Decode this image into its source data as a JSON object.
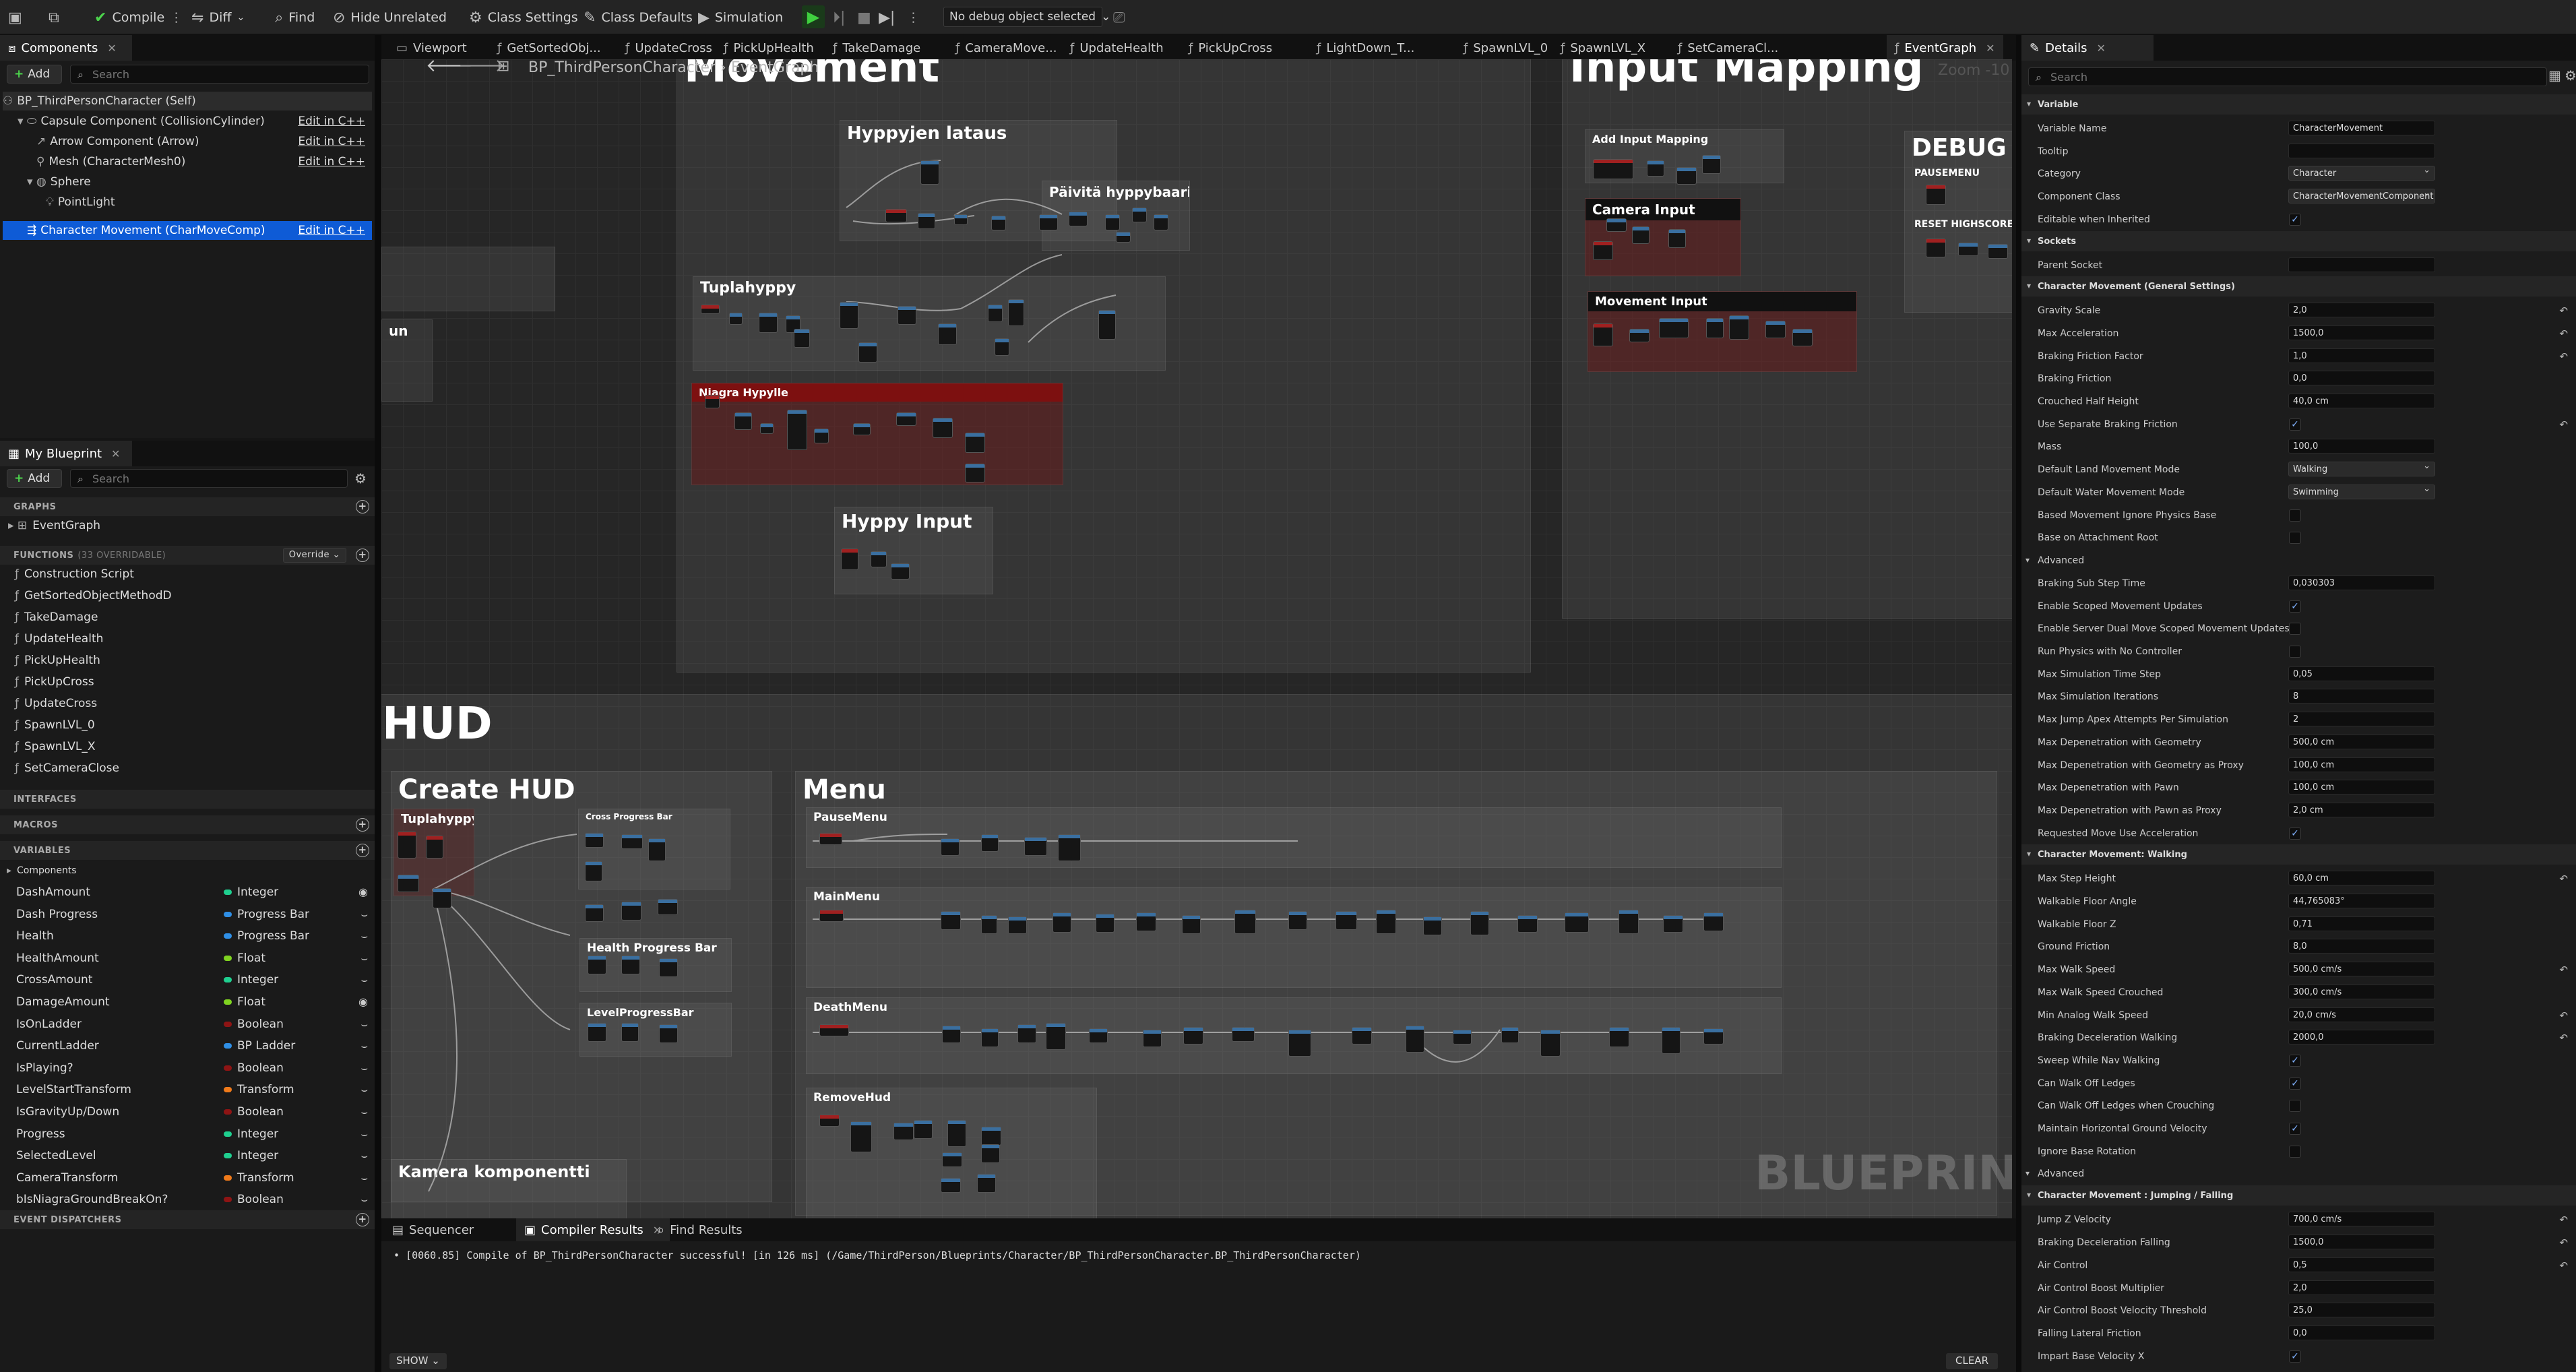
{
  "toolbar": {
    "compile": "Compile",
    "diff": "Diff",
    "find": "Find",
    "hide_unrelated": "Hide Unrelated",
    "class_settings": "Class Settings",
    "class_defaults": "Class Defaults",
    "simulation": "Simulation",
    "debug_object": "No debug object selected"
  },
  "components_panel": {
    "tab": "Components",
    "add": "Add",
    "search_placeholder": "Search",
    "items": [
      {
        "label": "BP_ThirdPersonCharacter (Self)",
        "edit": ""
      },
      {
        "label": "Capsule Component (CollisionCylinder)",
        "edit": "Edit in C++"
      },
      {
        "label": "Arrow Component (Arrow)",
        "edit": "Edit in C++"
      },
      {
        "label": "Mesh (CharacterMesh0)",
        "edit": "Edit in C++"
      },
      {
        "label": "Sphere",
        "edit": ""
      },
      {
        "label": "PointLight",
        "edit": ""
      },
      {
        "label": "Character Movement (CharMoveComp)",
        "edit": "Edit in C++"
      }
    ]
  },
  "my_blueprint": {
    "tab": "My Blueprint",
    "add": "Add",
    "search_placeholder": "Search",
    "graphs_header": "GRAPHS",
    "event_graph": "EventGraph",
    "functions_header": "FUNCTIONS",
    "functions_count": "(33 OVERRIDABLE)",
    "override": "Override",
    "functions": [
      "Construction Script",
      "GetSortedObjectMethodD",
      "TakeDamage",
      "UpdateHealth",
      "PickUpHealth",
      "PickUpCross",
      "UpdateCross",
      "SpawnLVL_0",
      "SpawnLVL_X",
      "SetCameraClose"
    ],
    "interfaces_header": "INTERFACES",
    "macros_header": "MACROS",
    "variables_header": "VARIABLES",
    "components_group": "Components",
    "variables": [
      {
        "name": "DashAmount",
        "type": "Integer",
        "color": "#1fcf8f"
      },
      {
        "name": "Dash Progress",
        "type": "Progress Bar",
        "color": "#2f8fe6"
      },
      {
        "name": "Health",
        "type": "Progress Bar",
        "color": "#2f8fe6"
      },
      {
        "name": "HealthAmount",
        "type": "Float",
        "color": "#7fd320"
      },
      {
        "name": "CrossAmount",
        "type": "Integer",
        "color": "#1fcf8f"
      },
      {
        "name": "DamageAmount",
        "type": "Float",
        "color": "#7fd320"
      },
      {
        "name": "IsOnLadder",
        "type": "Boolean",
        "color": "#8e1414"
      },
      {
        "name": "CurrentLadder",
        "type": "BP Ladder",
        "color": "#2f8fe6"
      },
      {
        "name": "IsPlaying?",
        "type": "Boolean",
        "color": "#8e1414"
      },
      {
        "name": "LevelStartTransform",
        "type": "Transform",
        "color": "#f07a1a"
      },
      {
        "name": "IsGravityUp/Down",
        "type": "Boolean",
        "color": "#8e1414"
      },
      {
        "name": "Progress",
        "type": "Integer",
        "color": "#1fcf8f"
      },
      {
        "name": "SelectedLevel",
        "type": "Integer",
        "color": "#1fcf8f"
      },
      {
        "name": "CameraTransform",
        "type": "Transform",
        "color": "#f07a1a"
      },
      {
        "name": "bIsNiagraGroundBreakOn?",
        "type": "Boolean",
        "color": "#8e1414"
      }
    ],
    "event_dispatchers_header": "EVENT DISPATCHERS"
  },
  "editor_tabs": [
    "Viewport",
    "GetSortedObj...",
    "UpdateCross",
    "PickUpHealth",
    "TakeDamage",
    "CameraMove...",
    "UpdateHealth",
    "PickUpCross",
    "LightDown_T...",
    "SpawnLVL_0",
    "SpawnLVL_X",
    "SetCameraCl...",
    "EventGraph"
  ],
  "graph": {
    "breadcrumb_bp": "BP_ThirdPersonCharacter",
    "breadcrumb_graph": "EventGraph",
    "zoom": "Zoom -10",
    "watermark": "BLUEPRINT",
    "comments": {
      "movement": "Movement",
      "hyppyjen_lataus": "Hyppyjen lataus",
      "paivita": "Päivitä hyppybaaria",
      "tuplahyppy": "Tuplahyppy",
      "niagra": "Niagra Hypylle",
      "hyppy_input": "Hyppy Input",
      "un": "un",
      "input_mapping": "Input Mapping",
      "add_input_mapping": "Add Input Mapping",
      "camera_input": "Camera Input",
      "movement_input": "Movement Input",
      "debug": "DEBUG P",
      "pausemenu_dbg": "PAUSEMENU",
      "reset_highscore": "RESET HIGHSCORE",
      "hud": "HUD",
      "create_hud": "Create HUD",
      "tuplahyppy2": "Tuplahyppy",
      "cross_progress": "Cross Progress Bar",
      "health_progress": "Health Progress Bar",
      "level_progress": "LevelProgressBar",
      "kamera": "Kamera komponentti",
      "menu": "Menu",
      "pausemenu": "PauseMenu",
      "mainmenu": "MainMenu",
      "deathmenu": "DeathMenu",
      "removehud": "RemoveHud"
    }
  },
  "bottom": {
    "tabs": [
      "Sequencer",
      "Compiler Results",
      "Find Results"
    ],
    "log": "[0060.85] Compile of BP_ThirdPersonCharacter successful! [in 126 ms] (/Game/ThirdPerson/Blueprints/Character/BP_ThirdPersonCharacter.BP_ThirdPersonCharacter)",
    "show": "SHOW",
    "clear": "CLEAR"
  },
  "details": {
    "tab": "Details",
    "search_placeholder": "Search"
  },
  "details_rows": [
    {
      "kind": "sec",
      "label": "Variable"
    },
    {
      "kind": "text",
      "label": "Variable Name",
      "value": "CharacterMovement"
    },
    {
      "kind": "text",
      "label": "Tooltip",
      "value": ""
    },
    {
      "kind": "dd",
      "label": "Category",
      "value": "Character"
    },
    {
      "kind": "dd",
      "label": "Component Class",
      "value": "CharacterMovementComponent"
    },
    {
      "kind": "cb",
      "label": "Editable when Inherited",
      "value": "✓"
    },
    {
      "kind": "sec",
      "label": "Sockets"
    },
    {
      "kind": "text",
      "label": "Parent Socket",
      "value": ""
    },
    {
      "kind": "sec",
      "label": "Character Movement (General Settings)"
    },
    {
      "kind": "text",
      "label": "Gravity Scale",
      "value": "2,0",
      "reset": true
    },
    {
      "kind": "text",
      "label": "Max Acceleration",
      "value": "1500,0",
      "reset": true
    },
    {
      "kind": "text",
      "label": "Braking Friction Factor",
      "value": "1,0",
      "reset": true
    },
    {
      "kind": "text",
      "label": "Braking Friction",
      "value": "0,0"
    },
    {
      "kind": "text",
      "label": "Crouched Half Height",
      "value": "40,0 cm"
    },
    {
      "kind": "cb",
      "label": "Use Separate Braking Friction",
      "value": "✓",
      "reset": true
    },
    {
      "kind": "text",
      "label": "Mass",
      "value": "100,0"
    },
    {
      "kind": "dd",
      "label": "Default Land Movement Mode",
      "value": "Walking"
    },
    {
      "kind": "dd",
      "label": "Default Water Movement Mode",
      "value": "Swimming"
    },
    {
      "kind": "cb",
      "label": "Based Movement Ignore Physics Base",
      "value": ""
    },
    {
      "kind": "cb",
      "label": "Base on Attachment Root",
      "value": ""
    },
    {
      "kind": "sub",
      "label": "Advanced"
    },
    {
      "kind": "text",
      "label": "Braking Sub Step Time",
      "value": "0,030303"
    },
    {
      "kind": "cb",
      "label": "Enable Scoped Movement Updates",
      "value": "✓"
    },
    {
      "kind": "cb",
      "label": "Enable Server Dual Move Scoped Movement Updates",
      "value": ""
    },
    {
      "kind": "cb",
      "label": "Run Physics with No Controller",
      "value": ""
    },
    {
      "kind": "text",
      "label": "Max Simulation Time Step",
      "value": "0,05"
    },
    {
      "kind": "text",
      "label": "Max Simulation Iterations",
      "value": "8"
    },
    {
      "kind": "text",
      "label": "Max Jump Apex Attempts Per Simulation",
      "value": "2"
    },
    {
      "kind": "text",
      "label": "Max Depenetration with Geometry",
      "value": "500,0 cm"
    },
    {
      "kind": "text",
      "label": "Max Depenetration with Geometry as Proxy",
      "value": "100,0 cm"
    },
    {
      "kind": "text",
      "label": "Max Depenetration with Pawn",
      "value": "100,0 cm"
    },
    {
      "kind": "text",
      "label": "Max Depenetration with Pawn as Proxy",
      "value": "2,0 cm"
    },
    {
      "kind": "cb",
      "label": "Requested Move Use Acceleration",
      "value": "✓"
    },
    {
      "kind": "sec",
      "label": "Character Movement: Walking"
    },
    {
      "kind": "text",
      "label": "Max Step Height",
      "value": "60,0 cm",
      "reset": true
    },
    {
      "kind": "text",
      "label": "Walkable Floor Angle",
      "value": "44,765083°"
    },
    {
      "kind": "text",
      "label": "Walkable Floor Z",
      "value": "0,71"
    },
    {
      "kind": "text",
      "label": "Ground Friction",
      "value": "8,0"
    },
    {
      "kind": "text",
      "label": "Max Walk Speed",
      "value": "500,0 cm/s",
      "reset": true
    },
    {
      "kind": "text",
      "label": "Max Walk Speed Crouched",
      "value": "300,0 cm/s"
    },
    {
      "kind": "text",
      "label": "Min Analog Walk Speed",
      "value": "20,0 cm/s",
      "reset": true
    },
    {
      "kind": "text",
      "label": "Braking Deceleration Walking",
      "value": "2000,0",
      "reset": true
    },
    {
      "kind": "cb",
      "label": "Sweep While Nav Walking",
      "value": "✓"
    },
    {
      "kind": "cb",
      "label": "Can Walk Off Ledges",
      "value": "✓"
    },
    {
      "kind": "cb",
      "label": "Can Walk Off Ledges when Crouching",
      "value": ""
    },
    {
      "kind": "cb",
      "label": "Maintain Horizontal Ground Velocity",
      "value": "✓"
    },
    {
      "kind": "cb",
      "label": "Ignore Base Rotation",
      "value": ""
    },
    {
      "kind": "sub",
      "label": "Advanced"
    },
    {
      "kind": "sec",
      "label": "Character Movement : Jumping / Falling"
    },
    {
      "kind": "text",
      "label": "Jump Z Velocity",
      "value": "700,0 cm/s",
      "reset": true
    },
    {
      "kind": "text",
      "label": "Braking Deceleration Falling",
      "value": "1500,0",
      "reset": true
    },
    {
      "kind": "text",
      "label": "Air Control",
      "value": "0,5",
      "reset": true
    },
    {
      "kind": "text",
      "label": "Air Control Boost Multiplier",
      "value": "2,0"
    },
    {
      "kind": "text",
      "label": "Air Control Boost Velocity Threshold",
      "value": "25,0"
    },
    {
      "kind": "text",
      "label": "Falling Lateral Friction",
      "value": "0,0"
    },
    {
      "kind": "cb",
      "label": "Impart Base Velocity X",
      "value": "✓"
    }
  ]
}
